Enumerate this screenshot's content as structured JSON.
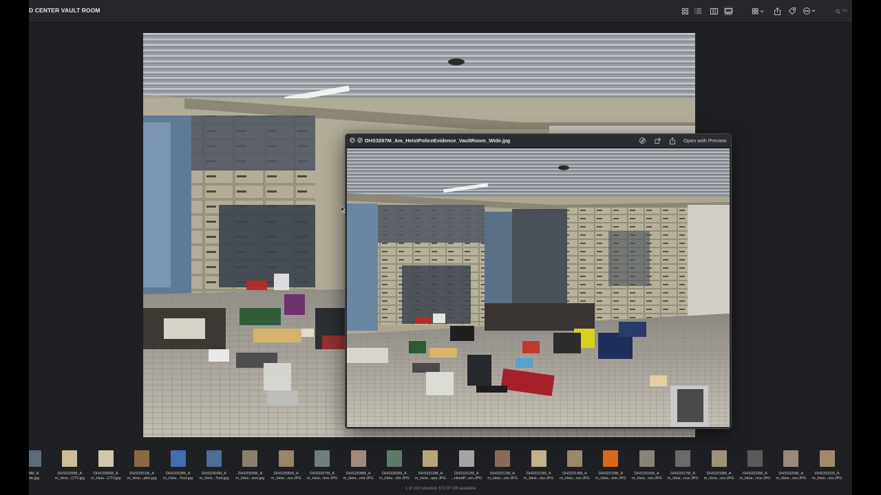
{
  "window": {
    "title": "D CENTER VAULT ROOM"
  },
  "toolbar": {
    "icons": [
      "grid-view-icon",
      "list-view-icon",
      "columns-view-icon",
      "gallery-view-icon",
      "group-icon",
      "share-icon",
      "tag-icon",
      "more-icon",
      "search-icon"
    ],
    "search_placeholder": "Se"
  },
  "quicklook": {
    "filename": "DHS3297M_Am_HeistPoliceEvidence_VaultRoom_Wide.jpg",
    "open_with_label": "Open with Preview"
  },
  "filmstrip": {
    "items": [
      {
        "l1": "8M_A",
        "l2": "ide.jpg",
        "color": "#5a6b7a"
      },
      {
        "l1": "DHS3299M_A",
        "l2": "m_Heis...CTV.jpg",
        "color": "#cdbd94"
      },
      {
        "l1": "DHS3300M_A",
        "l2": "m_Heis...CTV.jpg",
        "color": "#d2c8aa"
      },
      {
        "l1": "DHS3301M_A",
        "l2": "m_Heis...akin.jpg",
        "color": "#8a6a45"
      },
      {
        "l1": "DHS3303M_A",
        "l2": "m_Heis...Tool.jpg",
        "color": "#3f6fb0"
      },
      {
        "l1": "DHS3304M_A",
        "l2": "m_Heis...Tool.jpg",
        "color": "#4d6d9a"
      },
      {
        "l1": "DHS3305M_A",
        "l2": "m_Heis...tem.jpg",
        "color": "#8a7f70"
      },
      {
        "l1": "DHS3306M_A",
        "l2": "m_Heis...oor.JPG",
        "color": "#9a8566"
      },
      {
        "l1": "DHS3307M_A",
        "l2": "m_Heis...lsm.JPG",
        "color": "#6d7f80"
      },
      {
        "l1": "DHS3308M_A",
        "l2": "m_Heis...red.JPG",
        "color": "#a08a7a"
      },
      {
        "l1": "DHS3309M_A",
        "l2": "m_Heis...dor.JPG",
        "color": "#5f7a6a"
      },
      {
        "l1": "DHS3310M_A",
        "l2": "m_Heis...ape.JPG",
        "color": "#b8a67a"
      },
      {
        "l1": "DHS3311M_A",
        "l2": "...HeistP...sm.JPG",
        "color": "#a5a5a5"
      },
      {
        "l1": "DHS3312M_A",
        "l2": "m_Heis...oor.JPG",
        "color": "#8c6a5a"
      },
      {
        "l1": "DHS3313M_A",
        "l2": "m_Heis...dor.JPG",
        "color": "#c2b28a"
      },
      {
        "l1": "DHS3314M_A",
        "l2": "m_Heis...oor.JPG",
        "color": "#9a8a6a"
      },
      {
        "l1": "DHS3315M_A",
        "l2": "m_Heis...lsm.JPG",
        "color": "#d46a1a"
      },
      {
        "l1": "DHS3316M_A",
        "l2": "m_Heis...oor.JPG",
        "color": "#8a8478"
      },
      {
        "l1": "DHS3317M_A",
        "l2": "m_Heis...nce.JPG",
        "color": "#6a6a6a"
      },
      {
        "l1": "DHS3318M_A",
        "l2": "m_Heis...oor.JPG",
        "color": "#a0927a"
      },
      {
        "l1": "DHS3319M_A",
        "l2": "m_Heis...nce.JPG",
        "color": "#5a5a5a"
      },
      {
        "l1": "DHS3320M_A",
        "l2": "m_Heis...oor.JPG",
        "color": "#9a8a7a"
      },
      {
        "l1": "DHS3321M_A",
        "l2": "m_Heis...oor.JPG",
        "color": "#a08a6a"
      },
      {
        "l1": "DHS",
        "l2": "m_H",
        "color": "#7a6a5a"
      }
    ]
  },
  "status": "1 of 119 selected, 872.87 GB available"
}
